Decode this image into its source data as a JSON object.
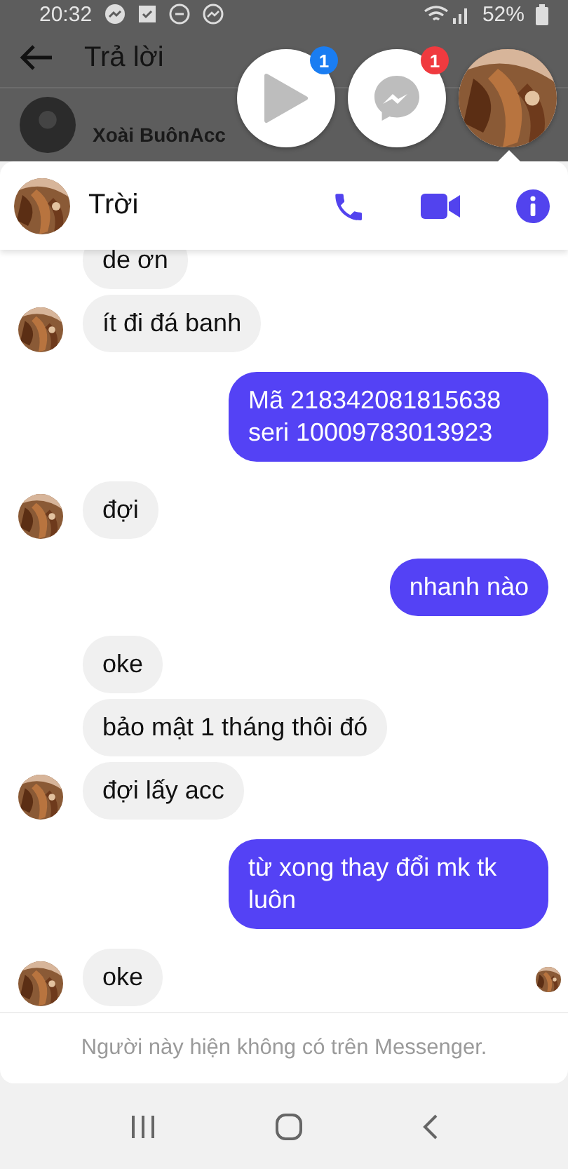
{
  "status_bar": {
    "time": "20:32",
    "battery": "52%"
  },
  "background_app": {
    "title": "Trả lời",
    "contact": "Xoài BuônAcc"
  },
  "chat_heads": [
    {
      "kind": "video",
      "badge": "1",
      "color": "#1a7df2"
    },
    {
      "kind": "messenger",
      "badge": "1",
      "color": "#f03a3f"
    },
    {
      "kind": "avatar"
    }
  ],
  "conversation": {
    "name": "Trời",
    "read_receipt": true,
    "messages": [
      {
        "kind": "received",
        "text": "de ơn",
        "avatar": false
      },
      {
        "kind": "received",
        "text": "ít đi đá banh",
        "avatar": true
      },
      {
        "kind": "sent",
        "text": "Mã 218342081815638 seri 10009783013923"
      },
      {
        "kind": "received",
        "text": "đợi",
        "avatar": true
      },
      {
        "kind": "sent",
        "text": "nhanh nào"
      },
      {
        "kind": "received",
        "text": "oke",
        "avatar": false
      },
      {
        "kind": "received",
        "text": "bảo mật 1 tháng thôi đó",
        "avatar": false
      },
      {
        "kind": "received",
        "text": "đợi lấy acc",
        "avatar": true
      },
      {
        "kind": "sent",
        "text": "từ xong thay đổi mk tk luôn"
      },
      {
        "kind": "received",
        "text": "oke",
        "avatar": true
      }
    ],
    "footer": "Người này hiện không có trên Messenger."
  }
}
